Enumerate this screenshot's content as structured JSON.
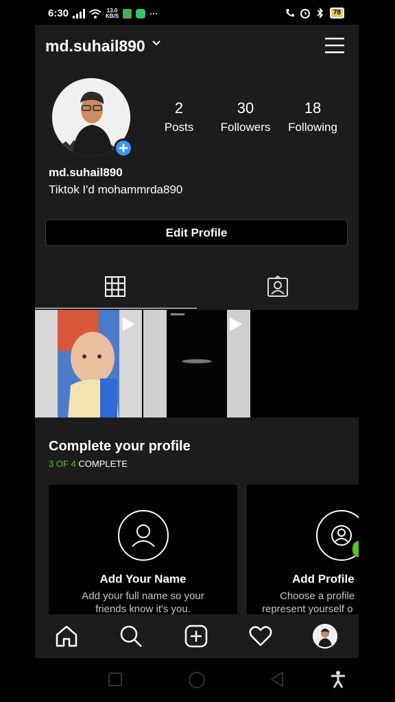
{
  "status_bar": {
    "time": "6:30",
    "network_speed_value": "13.0",
    "network_speed_unit": "KB/S",
    "more": "···",
    "battery": "78"
  },
  "profile": {
    "username": "md.suhail890",
    "display_name": "md.suhail890",
    "bio": "Tiktok I'd mohammrda890",
    "stats": [
      {
        "value": "2",
        "label": "Posts"
      },
      {
        "value": "30",
        "label": "Followers"
      },
      {
        "value": "18",
        "label": "Following"
      }
    ],
    "edit_button": "Edit Profile"
  },
  "complete_profile": {
    "title": "Complete your profile",
    "progress": "3 OF 4",
    "progress_suffix": " COMPLETE",
    "cards": [
      {
        "title": "Add Your Name",
        "desc_line1": "Add your full name so your",
        "desc_line2": "friends know it's you."
      },
      {
        "title": "Add Profile",
        "desc_line1": "Choose a profile",
        "desc_line2": "represent yourself o"
      }
    ]
  },
  "colors": {
    "background": "#1c1c1c",
    "accent_blue": "#3897f0",
    "accent_green": "#58c322"
  }
}
